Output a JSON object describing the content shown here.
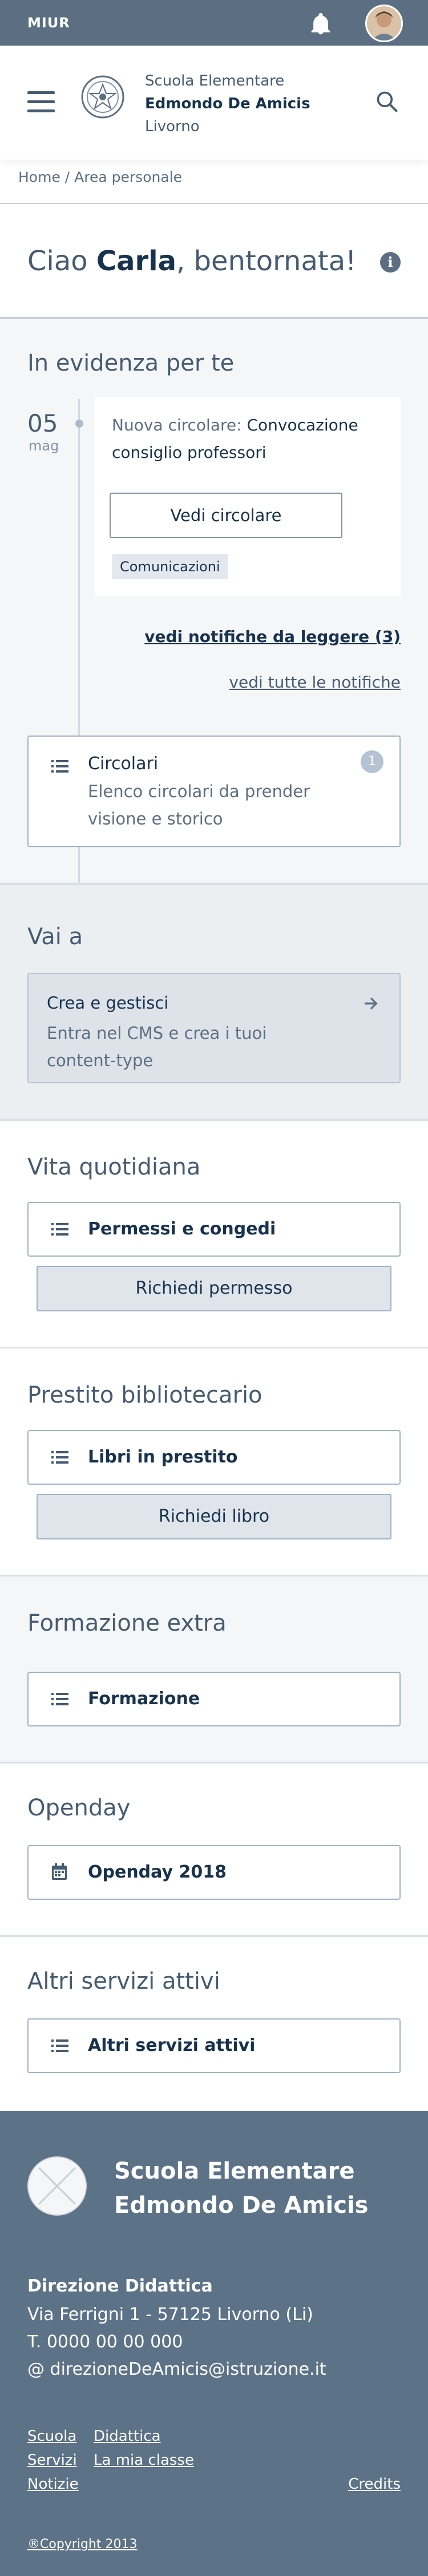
{
  "slim_header": {
    "brand": "MIUR"
  },
  "header": {
    "school_line1": "Scuola Elementare",
    "school_line2": "Edmondo De Amicis",
    "school_line3": "Livorno"
  },
  "breadcrumb": {
    "home": "Home",
    "separator": " / ",
    "current": "Area personale"
  },
  "greeting": {
    "prefix": "Ciao ",
    "name": "Carla",
    "suffix": ", bentornata!"
  },
  "highlights": {
    "title": "In evidenza per te",
    "date_day": "05",
    "date_month": "mag",
    "notification": {
      "prefix": "Nuova circolare: ",
      "subject": "Convocazione consiglio professori",
      "button": "Vedi circolare",
      "tag": "Comunicazioni"
    },
    "unread_link": "vedi notifiche da leggere (3)",
    "all_link": "vedi tutte le notifiche",
    "circolari": {
      "title": "Circolari",
      "description": "Elenco circolari da prender visione e storico",
      "badge": "1"
    }
  },
  "goto": {
    "title": "Vai a",
    "card_title": "Crea e gestisci",
    "card_desc": "Entra nel CMS e crea i tuoi content-type"
  },
  "daily": {
    "title": "Vita quotidiana",
    "item": "Permessi e congedi",
    "button": "Richiedi permesso"
  },
  "library": {
    "title": "Prestito bibliotecario",
    "item": "Libri in prestito",
    "button": "Richiedi libro"
  },
  "training": {
    "title": "Formazione extra",
    "item": "Formazione"
  },
  "openday": {
    "title": "Openday",
    "item": "Openday 2018"
  },
  "other": {
    "title": "Altri servizi attivi",
    "item": "Altri servizi attivi"
  },
  "footer": {
    "school_line1": "Scuola Elementare",
    "school_line2": "Edmondo De Amicis",
    "office": "Direzione Didattica",
    "address": "Via Ferrigni 1 - 57125 Livorno (Li)",
    "phone": "T. 0000 00 00 000",
    "email": "@ direzioneDeAmicis@istruzione.it",
    "links_col1": [
      "Scuola",
      "Servizi",
      "Notizie"
    ],
    "links_col2": [
      "Didattica",
      "La mia classe"
    ],
    "credits": "Credits",
    "copyright": "®Copyright 2013"
  },
  "icons": {
    "bell": "bell-icon",
    "search": "search-icon",
    "info": "info-icon",
    "list": "list-icon",
    "calendar": "calendar-icon",
    "arrow": "arrow-right-icon",
    "menu": "hamburger-icon"
  },
  "colors": {
    "topbar": "#5c6f82",
    "footer": "#5c7287",
    "text_primary": "#17324d",
    "text_secondary": "#455b71",
    "section_bg": "#f5f6f7"
  }
}
